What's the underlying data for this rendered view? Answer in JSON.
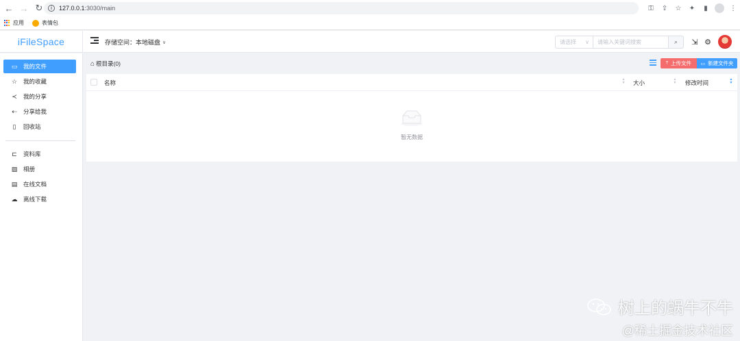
{
  "browser": {
    "url_host": "127.0.0.1",
    "url_path": ":3030/main",
    "bookmarks": [
      {
        "label": "应用",
        "icon": "apps-grid-icon"
      },
      {
        "label": "表情包",
        "icon": "emoji-icon"
      }
    ]
  },
  "header": {
    "logo": "iFileSpace",
    "storage_label": "存储空间：本地磁盘",
    "search": {
      "select_placeholder": "请选择",
      "keyword_placeholder": "请输入关键词搜索"
    }
  },
  "sidebar": {
    "items": [
      {
        "label": "我的文件",
        "icon": "folder-icon",
        "active": true
      },
      {
        "label": "我的收藏",
        "icon": "star-icon"
      },
      {
        "label": "我的分享",
        "icon": "share-icon"
      },
      {
        "label": "分享给我",
        "icon": "share-to-me-icon"
      },
      {
        "label": "回收站",
        "icon": "trash-icon"
      }
    ],
    "items2": [
      {
        "label": "资料库",
        "icon": "folder-open-icon"
      },
      {
        "label": "相册",
        "icon": "picture-icon"
      },
      {
        "label": "在线文档",
        "icon": "document-icon"
      },
      {
        "label": "离线下载",
        "icon": "cloud-download-icon"
      }
    ]
  },
  "main": {
    "breadcrumb": "根目录(0)",
    "upload_label": "上传文件",
    "new_folder_label": "新建文件夹",
    "columns": {
      "name": "名称",
      "size": "大小",
      "modified": "修改时间"
    },
    "empty_text": "暂无数据"
  },
  "watermark": {
    "line1": "树上的蜗牛不牛",
    "line2": "@稀土掘金技术社区"
  },
  "colors": {
    "primary": "#409eff",
    "danger": "#f56c6c"
  }
}
